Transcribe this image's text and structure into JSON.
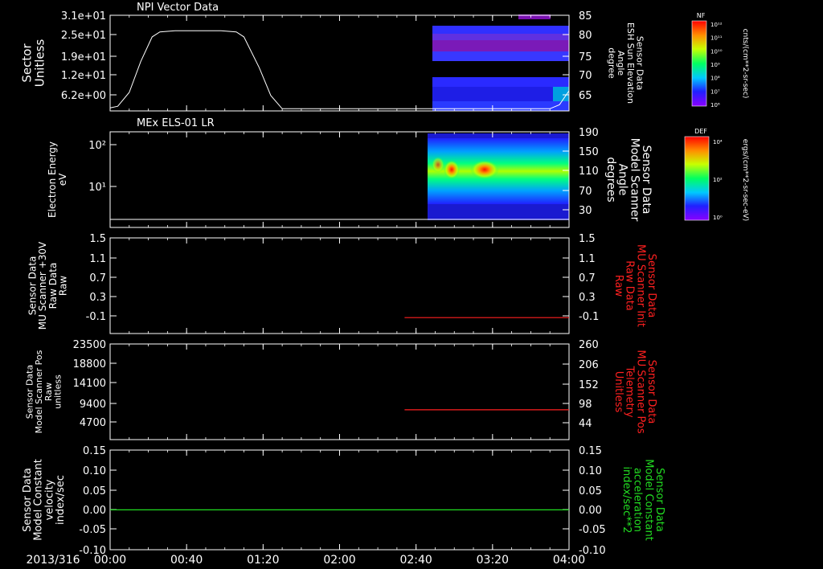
{
  "colors": {
    "white": "#ffffff",
    "red": "#ff2020",
    "green": "#22dd22",
    "background": "#000000"
  },
  "chart_data": [
    {
      "type": "line+heatmap",
      "title": "NPI Vector Data",
      "ylabel_left": [
        "Sector",
        "Unitless"
      ],
      "yticks_left": [
        "3.1e+01",
        "2.5e+01",
        "1.9e+01",
        "1.2e+01",
        "6.2e+00"
      ],
      "ylim_left": [
        0,
        31
      ],
      "ylabel_right": [
        "Sensor Data",
        "ESH Sun Elevation",
        "Angle",
        "degree"
      ],
      "yticks_right": [
        "85",
        "80",
        "75",
        "70",
        "65"
      ],
      "ylim_right": [
        60,
        85
      ],
      "line_series": {
        "color": "#ffffff",
        "x": [
          "00:00",
          "00:04",
          "00:10",
          "00:16",
          "00:22",
          "00:26",
          "00:34",
          "00:46",
          "00:58",
          "01:06",
          "01:10",
          "01:18",
          "01:24",
          "01:30",
          "02:40",
          "03:50",
          "03:55",
          "04:00"
        ],
        "y": [
          1,
          1.5,
          6,
          16,
          24,
          25.6,
          26,
          26,
          26,
          25.6,
          24,
          14,
          5,
          0.7,
          0.7,
          0.7,
          2,
          6.5
        ]
      },
      "heatmap_colorbar": {
        "label": "NF",
        "unit": "cnts/(cm**2-sr-sec)",
        "ticks": [
          "10¹²",
          "10¹¹",
          "10¹⁰",
          "10⁹",
          "10⁸",
          "10⁷",
          "10⁶"
        ]
      }
    },
    {
      "type": "heatmap",
      "title": "MEx ELS-01 LR",
      "ylabel_left": [
        "Electron Energy",
        "eV"
      ],
      "yticks_left": [
        "10²",
        "10¹"
      ],
      "yscale_left": "log",
      "ylabel_right": [
        "Sensor Data",
        "Model Scanner",
        "Angle",
        "degrees"
      ],
      "yticks_right": [
        "190",
        "150",
        "110",
        "70",
        "30"
      ],
      "ylim_right": [
        0,
        190
      ],
      "heatmap_colorbar": {
        "label": "DEF",
        "unit": "ergs/(cm**2-sr-sec-eV)",
        "ticks": [
          "10⁴",
          "10²",
          "10⁰"
        ]
      }
    },
    {
      "type": "line",
      "ylabel_left": [
        "Sensor Data",
        "MU Scanner +30V",
        "Raw Data",
        "Raw"
      ],
      "yticks_left": [
        "1.5",
        "1.1",
        "0.7",
        "0.3",
        "-0.1"
      ],
      "ylim_left": [
        -0.3,
        1.5
      ],
      "ylabel_right": [
        "Sensor Data",
        "MU Scanner Init",
        "Raw Data",
        "Raw"
      ],
      "yticks_right": [
        "1.5",
        "1.1",
        "0.7",
        "0.3",
        "-0.1"
      ],
      "ylim_right": [
        -0.3,
        1.5
      ],
      "series": [
        {
          "color": "#ff2020",
          "axis": "right",
          "x": [
            "02:34",
            "04:00"
          ],
          "y": [
            0,
            0
          ]
        }
      ]
    },
    {
      "type": "line",
      "ylabel_left": [
        "Sensor Data",
        "Model Scanner Pos",
        "Raw",
        "unitless"
      ],
      "yticks_left": [
        "23500",
        "18800",
        "14100",
        "9400",
        "4700"
      ],
      "ylim_left": [
        0,
        23500
      ],
      "ylabel_right": [
        "Sensor Data",
        "MU Scanner Pos",
        "Telemetry",
        "Unitless"
      ],
      "yticks_right": [
        "260",
        "206",
        "152",
        "98",
        "44"
      ],
      "ylim_right": [
        0,
        260
      ],
      "series": [
        {
          "color": "#ff2020",
          "axis": "right",
          "x": [
            "02:34",
            "04:00"
          ],
          "y": [
            81,
            81
          ]
        }
      ]
    },
    {
      "type": "line",
      "ylabel_left": [
        "Sensor Data",
        "Model Constant",
        "velocity",
        "index/sec"
      ],
      "yticks_left": [
        "0.15",
        "0.10",
        "0.05",
        "0.00",
        "-0.05",
        "-0.10"
      ],
      "ylim_left": [
        -0.1,
        0.15
      ],
      "ylabel_right": [
        "Sensor Data",
        "Model Constant",
        "acceleration",
        "index/sec**2"
      ],
      "yticks_right": [
        "0.15",
        "0.10",
        "0.05",
        "0.00",
        "-0.05",
        "-0.10"
      ],
      "ylim_right": [
        -0.1,
        0.15
      ],
      "series": [
        {
          "color": "#22dd22",
          "axis": "left",
          "x": [
            "00:00",
            "04:00"
          ],
          "y": [
            0,
            0
          ]
        }
      ]
    }
  ],
  "time_axis": {
    "date_label": "2013/316",
    "ticks": [
      "00:00",
      "00:40",
      "01:20",
      "02:00",
      "02:40",
      "03:20",
      "04:00"
    ]
  }
}
